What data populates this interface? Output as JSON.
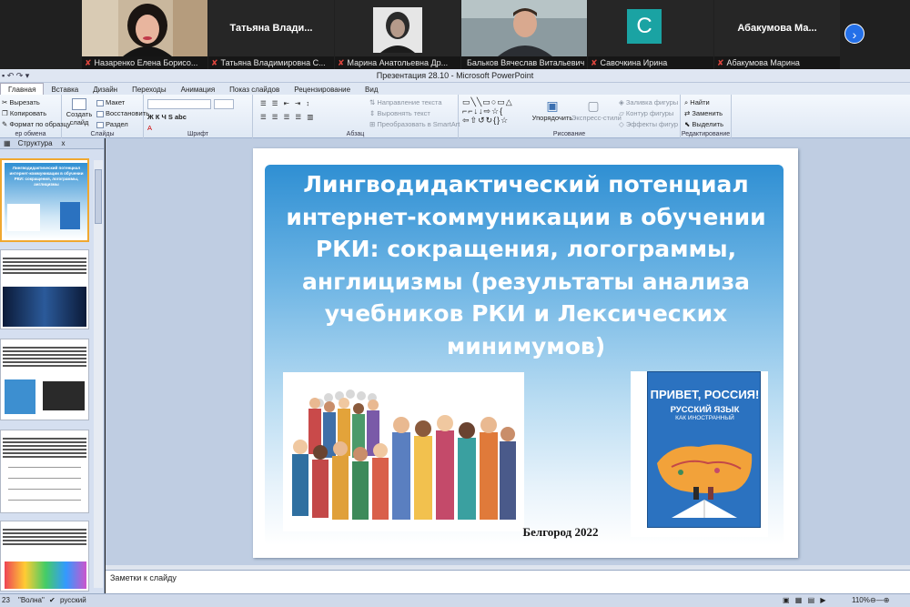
{
  "meeting": {
    "participants": [
      {
        "name": "Назаренко Елена Борисо...",
        "muted": true
      },
      {
        "name": "Татьяна Владимировна С...",
        "display": "Татьяна Влади...",
        "muted": true
      },
      {
        "name": "Марина Анатольевна Др...",
        "muted": true
      },
      {
        "name": "Бальков Вячеслав Витальевич",
        "muted": false
      },
      {
        "name": "Савочкина Ирина",
        "avatar_letter": "С",
        "muted": true
      },
      {
        "name": "Абакумова Марина",
        "display": "Абакумова Ма...",
        "muted": true
      }
    ],
    "next_icon": "chevron-right-icon"
  },
  "window": {
    "title": "Презентация 28.10 - Microsoft PowerPoint"
  },
  "ribbon": {
    "tabs": [
      "Главная",
      "Вставка",
      "Дизайн",
      "Переходы",
      "Анимация",
      "Показ слайдов",
      "Рецензирование",
      "Вид"
    ],
    "clipboard": {
      "cut": "Вырезать",
      "copy": "Копировать",
      "format": "Формат по образцу",
      "label": "ер обмена"
    },
    "slides": {
      "new": "Создать",
      "new2": "слайд",
      "layout": "Макет",
      "reset": "Восстановить",
      "section": "Раздел",
      "label": "Слайды"
    },
    "font": {
      "label": "Шрифт"
    },
    "paragraph": {
      "text_dir": "Направление текста",
      "align": "Выровнять текст",
      "smartart": "Преобразовать в SmartArt",
      "label": "Абзац"
    },
    "drawing": {
      "arrange": "Упорядочить",
      "styles": "Экспресс-стили",
      "fill": "Заливка фигуры",
      "outline": "Контур фигуры",
      "effects": "Эффекты фигур",
      "label": "Рисование"
    },
    "editing": {
      "find": "Найти",
      "replace": "Заменить",
      "select": "Выделить",
      "label": "Редактирование"
    }
  },
  "pane": {
    "tab_structure": "Структура",
    "close": "x"
  },
  "slide": {
    "title": "Лингводидактический   потенциал интернет-коммуникации в обучении РКИ: сокращения, логограммы, англицизмы (результаты  анализа учебников РКИ и Лексических минимумов)",
    "city_year": "Белгород 2022",
    "book": {
      "title": "ПРИВЕТ, РОССИЯ!",
      "subtitle": "РУССКИЙ ЯЗЫК",
      "subtitle2": "КАК ИНОСТРАННЫЙ"
    }
  },
  "notes": {
    "placeholder": "Заметки к слайду"
  },
  "status": {
    "slide": "23",
    "theme": "\"Волна\"",
    "lang": "русский",
    "zoom": "110%"
  },
  "colors": {
    "accent": "#2b72c0",
    "banner_top": "#2f8fd3",
    "active_speaker": "#3bc44a"
  }
}
